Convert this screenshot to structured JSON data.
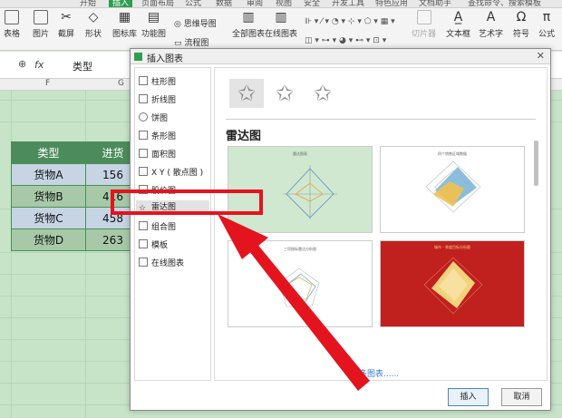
{
  "topbar": {
    "items": [
      {
        "label": "开始"
      },
      {
        "label": "插入",
        "active": true
      },
      {
        "label": "页面布局"
      },
      {
        "label": "公式"
      },
      {
        "label": "数据"
      },
      {
        "label": "审阅"
      },
      {
        "label": "视图"
      },
      {
        "label": "安全"
      },
      {
        "label": "开发工具"
      },
      {
        "label": "特色应用"
      },
      {
        "label": "文档助手"
      }
    ],
    "search": "查找命令、搜索模板"
  },
  "toolbar": {
    "table": "表格",
    "picture": "图片",
    "screenshot": "截屏",
    "shape": "形状",
    "iconlib": "图标库",
    "funcchart": "功能图",
    "mindmap": "思维导图",
    "flowchart": "流程图",
    "allcharts": "全部图表",
    "onlinecharts": "在线图表",
    "slicer": "切片器",
    "textbox": "文本框",
    "arttext": "艺术字",
    "symbol": "符号",
    "formula": "公式"
  },
  "formula_bar": {
    "fx": "fx",
    "value": "类型"
  },
  "columns": {
    "f": "F",
    "g": "G"
  },
  "table": {
    "header": [
      "类型",
      "进货"
    ],
    "rows": [
      {
        "type": "货物A",
        "value": "156"
      },
      {
        "type": "货物B",
        "value": "416"
      },
      {
        "type": "货物C",
        "value": "458"
      },
      {
        "type": "货物D",
        "value": "263"
      }
    ]
  },
  "dialog": {
    "title": "插入图表",
    "categories": [
      "柱形图",
      "折线图",
      "饼图",
      "条形图",
      "面积图",
      "X Y ( 散点图 )",
      "股价图",
      "雷达图",
      "组合图",
      "模板",
      "在线图表"
    ],
    "selected_index": 7,
    "section_title": "雷达图",
    "more_link": "更多图表......",
    "insert_button": "插入",
    "cancel_button": "取消",
    "template_titles": [
      "雷达图表",
      "四个销售区域数据",
      "三项指标雷达分析图",
      "城市 - 季度目标分析图"
    ]
  },
  "colors": {
    "accent": "#2e9e4f",
    "highlight": "#e3141d",
    "header_fill": "#4c8c5c"
  }
}
